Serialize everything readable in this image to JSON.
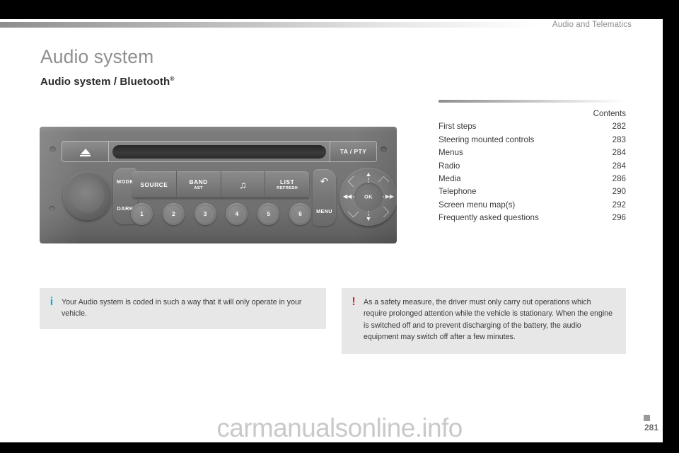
{
  "header": {
    "section_title": "Audio and Telematics"
  },
  "titles": {
    "page_title": "Audio system",
    "sub_title_a": "Audio system",
    "sub_title_sep": " / ",
    "sub_title_b": "Bluetooth",
    "sub_title_sup": "®"
  },
  "contents": {
    "label": "Contents",
    "rows": [
      {
        "label": "First steps",
        "page": "282"
      },
      {
        "label": "Steering mounted controls",
        "page": "283"
      },
      {
        "label": "Menus",
        "page": "284"
      },
      {
        "label": "Radio",
        "page": "284"
      },
      {
        "label": "Media",
        "page": "286"
      },
      {
        "label": "Telephone",
        "page": "290"
      },
      {
        "label": "Screen menu map(s)",
        "page": "292"
      },
      {
        "label": "Frequently asked questions",
        "page": "296"
      }
    ]
  },
  "radio": {
    "eject_label": "eject-icon",
    "ta_pty_label": "TA / PTY",
    "mode_label": "MODE",
    "dark_label": "DARK",
    "strip_buttons": [
      {
        "main": "SOURCE",
        "sub": ""
      },
      {
        "main": "BAND",
        "sub": "AST"
      },
      {
        "main": "♫",
        "sub": "",
        "is_icon": true
      },
      {
        "main": "LIST",
        "sub": "REFRESH"
      }
    ],
    "presets": [
      "1",
      "2",
      "3",
      "4",
      "5",
      "6"
    ],
    "back_icon": "↶",
    "menu_label": "MENU",
    "nav": {
      "ok_label": "OK",
      "up": "▲",
      "down": "▼",
      "left": "◀◀",
      "right": "▶▶"
    }
  },
  "callouts": {
    "info": {
      "icon": "i",
      "text": "Your Audio system is coded in such a way that it will only operate in your vehicle."
    },
    "warning": {
      "icon": "!",
      "text": "As a safety measure, the driver must only carry out operations which require prolonged attention while the vehicle is stationary. When the engine is switched off and to prevent discharging of the battery, the audio equipment may switch off after a few minutes."
    }
  },
  "footer": {
    "page_number": "281",
    "watermark": "carmanualsonline.info"
  },
  "colors": {
    "info_accent": "#00adef",
    "warning_accent": "#e1232e",
    "title_gray": "#8f8f8f",
    "body_gray": "#3a3a3a"
  }
}
